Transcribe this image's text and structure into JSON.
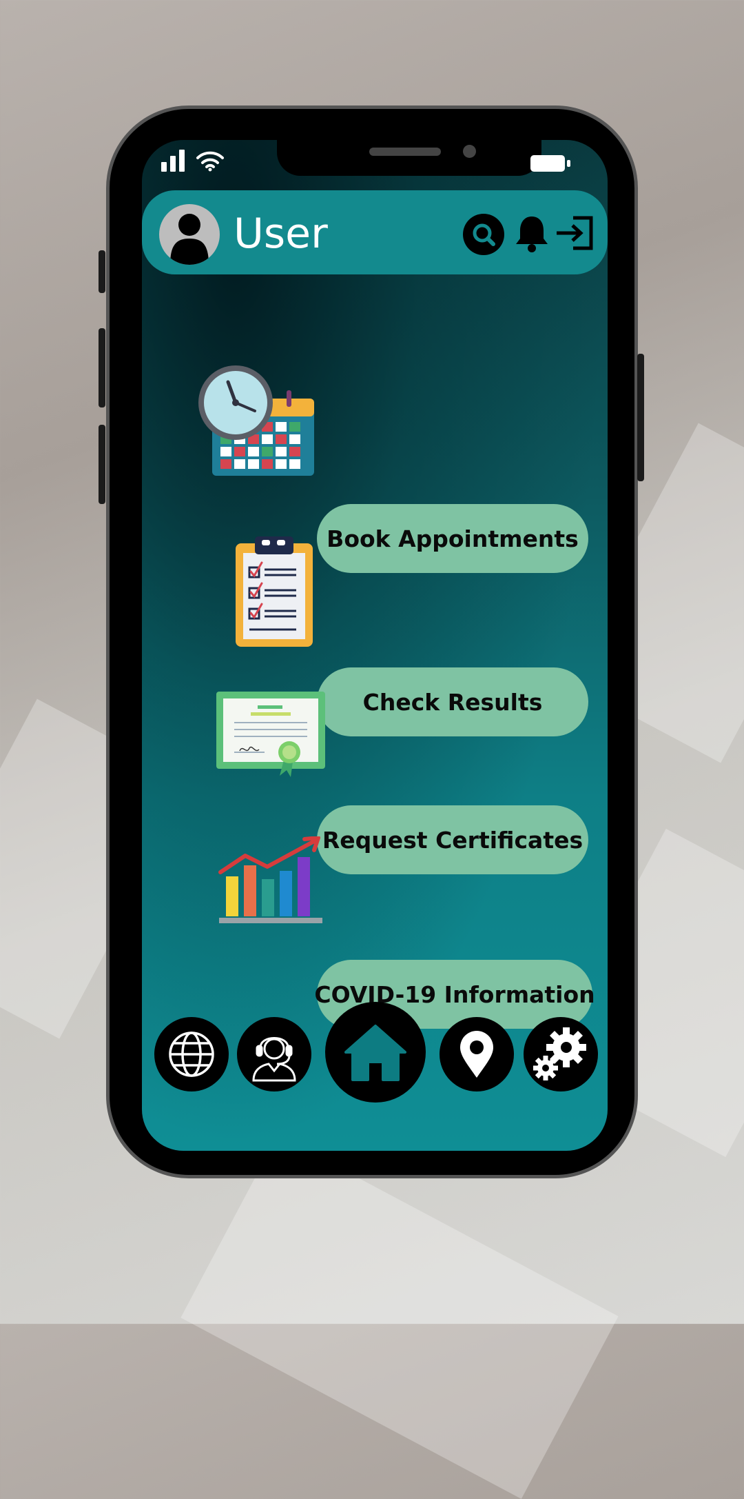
{
  "header": {
    "user_name": "User",
    "icons": [
      "avatar-icon",
      "search-icon",
      "bell-icon",
      "logout-icon"
    ]
  },
  "status_bar": {
    "icons": [
      "signal-icon",
      "wifi-icon",
      "battery-icon"
    ]
  },
  "menu": {
    "items": [
      {
        "label": "Book Appointments",
        "icon": "calendar-clock-icon"
      },
      {
        "label": "Check Results",
        "icon": "clipboard-checklist-icon"
      },
      {
        "label": "Request Certificates",
        "icon": "certificate-icon"
      },
      {
        "label": "COVID-19 Information",
        "icon": "bar-chart-icon"
      }
    ]
  },
  "bottom_nav": {
    "items": [
      "globe-icon",
      "support-agent-icon",
      "home-icon",
      "location-pin-icon",
      "settings-gears-icon"
    ]
  },
  "colors": {
    "header_bg": "#138a8e",
    "menu_button_bg": "#7fc3a3",
    "screen_bg": "#0e7f86"
  }
}
